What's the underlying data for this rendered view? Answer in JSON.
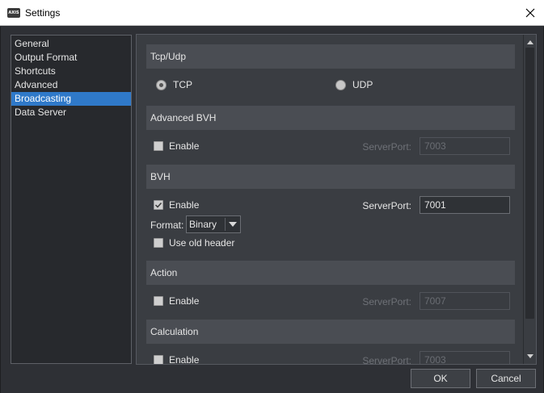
{
  "window": {
    "title": "Settings",
    "app_icon_text": "AXIS"
  },
  "nav": {
    "items": [
      {
        "label": "General",
        "selected": false
      },
      {
        "label": "Output Format",
        "selected": false
      },
      {
        "label": "Shortcuts",
        "selected": false
      },
      {
        "label": "Advanced",
        "selected": false
      },
      {
        "label": "Broadcasting",
        "selected": true
      },
      {
        "label": "Data Server",
        "selected": false
      }
    ]
  },
  "tcp_udp": {
    "header": "Tcp/Udp",
    "tcp_label": "TCP",
    "udp_label": "UDP",
    "selected": "TCP"
  },
  "advanced_bvh": {
    "header": "Advanced BVH",
    "enable_label": "Enable",
    "enabled": false,
    "port_label": "ServerPort:",
    "port_value": "7003"
  },
  "bvh": {
    "header": "BVH",
    "enable_label": "Enable",
    "enabled": true,
    "port_label": "ServerPort:",
    "port_value": "7001",
    "format_label": "Format:",
    "format_value": "Binary",
    "old_header_label": "Use old header",
    "old_header_checked": false
  },
  "action": {
    "header": "Action",
    "enable_label": "Enable",
    "enabled": false,
    "port_label": "ServerPort:",
    "port_value": "7007"
  },
  "calculation": {
    "header": "Calculation",
    "enable_label": "Enable",
    "enabled": false,
    "port_label": "ServerPort:",
    "port_value": "7003"
  },
  "buttons": {
    "ok_label": "OK",
    "cancel_label": "Cancel"
  },
  "colors": {
    "selection": "#2f79c9",
    "background": "#2e3035",
    "section_header": "#4a4d53"
  }
}
